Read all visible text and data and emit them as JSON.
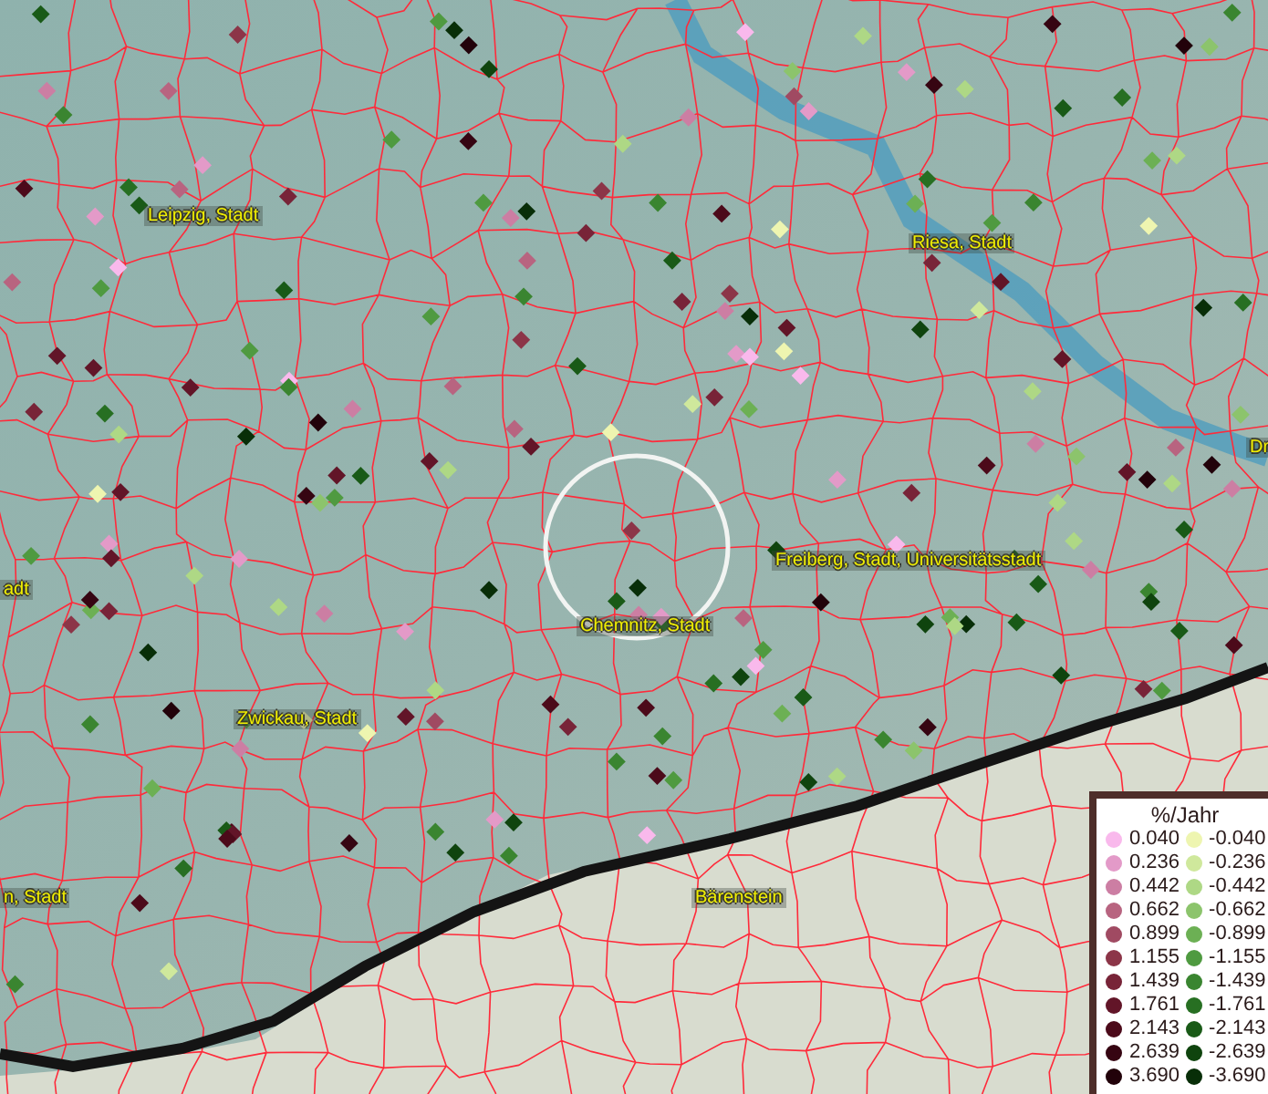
{
  "map": {
    "place_labels": [
      {
        "text": "Leipzig, Stadt"
      },
      {
        "text": "Riesa, Stadt"
      },
      {
        "text": "Dr"
      },
      {
        "text": "adt"
      },
      {
        "text": "Freiberg, Stadt, Universitätsstadt"
      },
      {
        "text": "Chemnitz, Stadt"
      },
      {
        "text": "Zwickau, Stadt"
      },
      {
        "text": "n, Stadt"
      },
      {
        "text": "Bärenstein"
      }
    ]
  },
  "legend": {
    "title": "%/Jahr",
    "positive": [
      {
        "value": "0.040",
        "color": "#f9b9ec"
      },
      {
        "value": "0.236",
        "color": "#e39ac8"
      },
      {
        "value": "0.442",
        "color": "#cc7ea3"
      },
      {
        "value": "0.662",
        "color": "#b86480"
      },
      {
        "value": "0.899",
        "color": "#a04a62"
      },
      {
        "value": "1.155",
        "color": "#8c3548"
      },
      {
        "value": "1.439",
        "color": "#782438"
      },
      {
        "value": "1.761",
        "color": "#621528"
      },
      {
        "value": "2.143",
        "color": "#4c0a1a"
      },
      {
        "value": "2.639",
        "color": "#360512"
      },
      {
        "value": "3.690",
        "color": "#22020a"
      }
    ],
    "negative": [
      {
        "value": "-0.040",
        "color": "#eef5b0"
      },
      {
        "value": "-0.236",
        "color": "#cfe89c"
      },
      {
        "value": "-0.442",
        "color": "#aed885"
      },
      {
        "value": "-0.662",
        "color": "#8cc46c"
      },
      {
        "value": "-0.899",
        "color": "#6cb054"
      },
      {
        "value": "-1.155",
        "color": "#4f9a40"
      },
      {
        "value": "-1.439",
        "color": "#3a8530"
      },
      {
        "value": "-1.761",
        "color": "#276f22"
      },
      {
        "value": "-2.143",
        "color": "#195a17"
      },
      {
        "value": "-2.639",
        "color": "#0f440e"
      },
      {
        "value": "-3.690",
        "color": "#082e08"
      }
    ]
  }
}
